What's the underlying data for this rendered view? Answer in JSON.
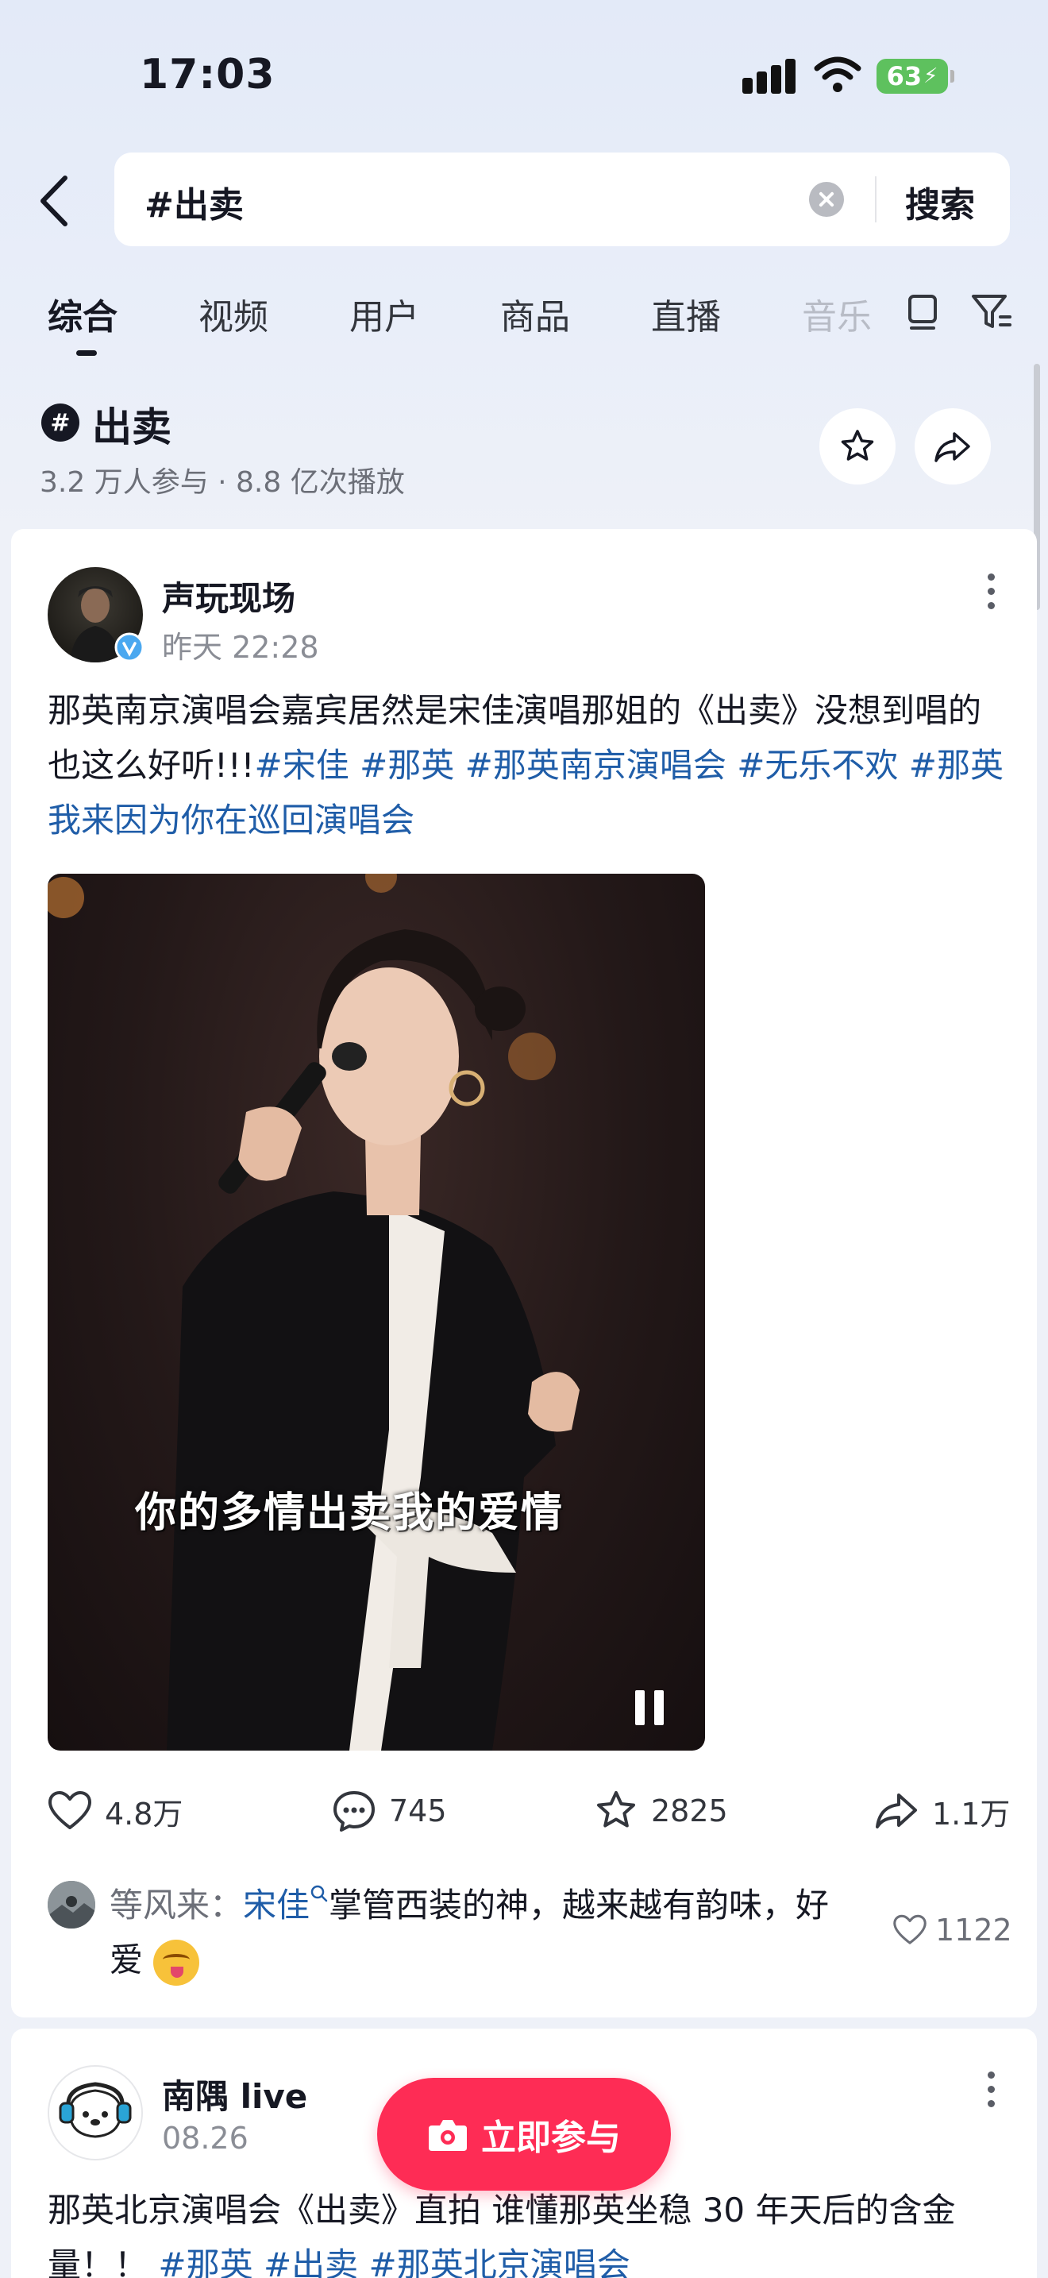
{
  "status_bar": {
    "time": "17:03",
    "battery": "63"
  },
  "search": {
    "query": "#出卖",
    "button": "搜索"
  },
  "tabs": [
    {
      "label": "综合"
    },
    {
      "label": "视频"
    },
    {
      "label": "用户"
    },
    {
      "label": "商品"
    },
    {
      "label": "直播"
    },
    {
      "label": "音乐"
    }
  ],
  "topic": {
    "badge": "#",
    "title": "出卖",
    "stats": "3.2 万人参与 · 8.8 亿次播放"
  },
  "posts": [
    {
      "author": "声玩现场",
      "time": "昨天 22:28",
      "caption_text": "那英南京演唱会嘉宾居然是宋佳演唱那姐的《出卖》没想到唱的也这么好听!!!",
      "tags": [
        "#宋佳",
        "#那英",
        "#那英南京演唱会",
        "#无乐不欢",
        "#那英我来因为你在巡回演唱会"
      ],
      "subtitle": "你的多情出卖我的爱情",
      "likes": "4.8万",
      "comments": "745",
      "favorites": "2825",
      "shares": "1.1万",
      "top_comment": {
        "author": "等风来：",
        "mention": "宋佳",
        "text": "掌管西装的神，越来越有韵味，好爱",
        "likes": "1122"
      }
    },
    {
      "author": "南隅 live",
      "time": "08.26",
      "caption_text": "那英北京演唱会《出卖》直拍 谁懂那英坐稳 30 年天后的含金量！！",
      "tags": [
        "#那英",
        "#出卖",
        "#那英北京演唱会"
      ]
    }
  ],
  "cta": {
    "label": "立即参与"
  },
  "colors": {
    "accent": "#fe2c55",
    "tag": "#1f5da8",
    "verified": "#4aa8f0"
  }
}
